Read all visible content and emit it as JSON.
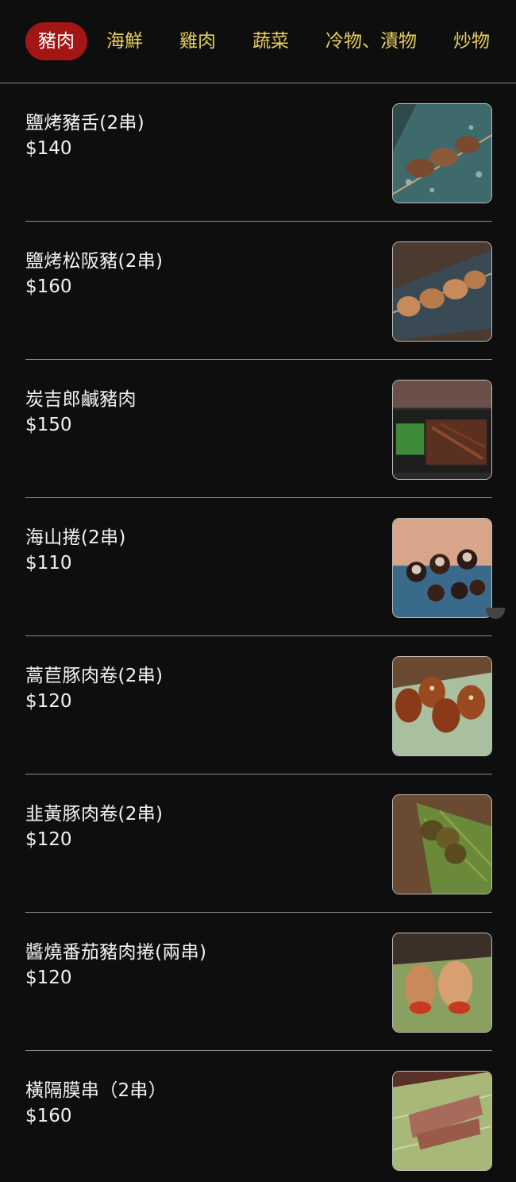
{
  "nav": {
    "tabs": [
      {
        "label": "豬肉",
        "active": true
      },
      {
        "label": "海鮮",
        "active": false
      },
      {
        "label": "雞肉",
        "active": false
      },
      {
        "label": "蔬菜",
        "active": false
      },
      {
        "label": "冷物、漬物",
        "active": false
      },
      {
        "label": "炒物",
        "active": false
      }
    ],
    "active_color": "#a21616",
    "tab_color": "#e7cf5d"
  },
  "menu": {
    "items": [
      {
        "name": "鹽烤豬舌(2串)",
        "price": "$140",
        "image": "grilled-pork-tongue-skewer-photo"
      },
      {
        "name": "鹽烤松阪豬(2串)",
        "price": "$160",
        "image": "grilled-pork-jowl-skewer-photo"
      },
      {
        "name": "炭吉郎鹹豬肉",
        "price": "$150",
        "image": "salted-pork-platter-photo"
      },
      {
        "name": "海山捲(2串)",
        "price": "$110",
        "image": "seaweed-pork-roll-skewer-photo"
      },
      {
        "name": "蒿苣豚肉卷(2串)",
        "price": "$120",
        "image": "lettuce-pork-roll-skewer-photo"
      },
      {
        "name": "韭黃豚肉卷(2串)",
        "price": "$120",
        "image": "chive-pork-roll-skewer-photo"
      },
      {
        "name": "醬燒番茄豬肉捲(兩串)",
        "price": "$120",
        "image": "tomato-pork-roll-skewer-photo"
      },
      {
        "name": "橫隔膜串（2串）",
        "price": "$160",
        "image": "skirt-steak-skewer-photo"
      }
    ]
  }
}
